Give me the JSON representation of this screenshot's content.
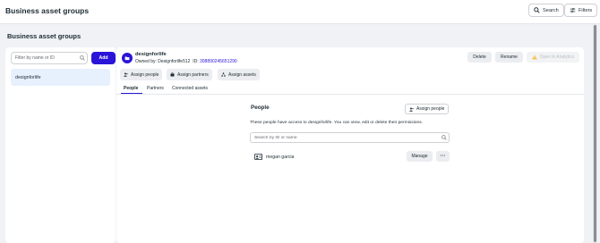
{
  "topbar": {
    "title": "Business asset groups",
    "search_label": "Search",
    "filters_label": "Filters"
  },
  "section": {
    "title": "Business asset groups"
  },
  "left_panel": {
    "filter_placeholder": "Filter by name or ID",
    "add_label": "Add",
    "items": [
      {
        "label": "designforlife",
        "selected": true
      }
    ]
  },
  "group": {
    "name": "designforlife",
    "owned_by_prefix": "Owned by: Designforlife512",
    "id_prefix": "ID:",
    "id_value": "308890245651290",
    "actions": {
      "delete": "Delete",
      "rename": "Rename",
      "analytics": "Open in Analytics"
    },
    "assign_buttons": {
      "people": "Assign people",
      "partners": "Assign partners",
      "assets": "Assign assets"
    },
    "tabs": [
      {
        "label": "People",
        "active": true
      },
      {
        "label": "Partners",
        "active": false
      },
      {
        "label": "Connected assets",
        "active": false
      }
    ]
  },
  "people": {
    "title": "People",
    "assign_label": "Assign people",
    "description": "These people have access to designforlife. You can view, edit or delete their permissions.",
    "search_placeholder": "Search by ID or name",
    "rows": [
      {
        "name": "megan garcia",
        "manage_label": "Manage",
        "more_label": "···"
      }
    ]
  },
  "colors": {
    "accent": "#2a14d8",
    "selected_bg": "#e7f0fd",
    "warning": "#f7b928"
  }
}
